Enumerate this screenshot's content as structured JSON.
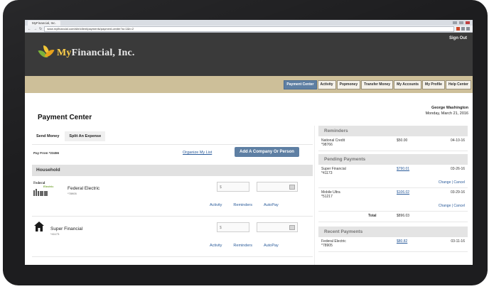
{
  "browser": {
    "tab_label": "MyFinancial, Inc.",
    "url": "www.myfinancial.com/site/client/payments/payment-center?a=1&b=2"
  },
  "header": {
    "logo_my": "My",
    "logo_rest": "Financial, Inc.",
    "sign_out": "Sign Out"
  },
  "nav": {
    "tabs": [
      "Payment Center",
      "Activity",
      "Popmoney",
      "Transfer Money",
      "My Accounts",
      "My Profile",
      "Help Center"
    ],
    "active": "Payment Center"
  },
  "page": {
    "title": "Payment Center",
    "user_name": "George Washington",
    "date": "Monday, March 21, 2016"
  },
  "left": {
    "subtabs": [
      "Send Money",
      "Split An Expense"
    ],
    "pay_from": "Pay From *23456",
    "organize_link": "Organize My List",
    "add_company": "Add A Company Or Person",
    "group": "Household",
    "payees": [
      {
        "name": "Federal Electric",
        "id": "*78905",
        "logo_top": "Federal",
        "logo_accent": "Electric",
        "amount_placeholder": "$",
        "links": [
          "Activity",
          "Reminders",
          "AutoPay"
        ]
      },
      {
        "name": "Super Financial",
        "id": "*41173",
        "amount_placeholder": "$",
        "links": [
          "Activity",
          "Reminders",
          "AutoPay"
        ]
      }
    ]
  },
  "reminders": {
    "title": "Reminders",
    "items": [
      {
        "name": "National Credit",
        "id": "*98766",
        "amount": "$50.00",
        "date": "04-10-16"
      }
    ]
  },
  "pending": {
    "title": "Pending Payments",
    "items": [
      {
        "name": "Super Financial",
        "id": "*41173",
        "amount": "$790.01",
        "date": "03-26-16",
        "actions": "Change | Cancel"
      },
      {
        "name": "Mobile Ultra",
        "id": "*51217",
        "amount": "$106.02",
        "date": "03-29-16",
        "actions": "Change | Cancel"
      }
    ],
    "total_label": "Total",
    "total_amount": "$896.03"
  },
  "recent": {
    "title": "Recent Payments",
    "items": [
      {
        "name": "Federal Electric",
        "id": "*78905",
        "amount": "$80.82",
        "date": "03-11-16"
      }
    ]
  }
}
